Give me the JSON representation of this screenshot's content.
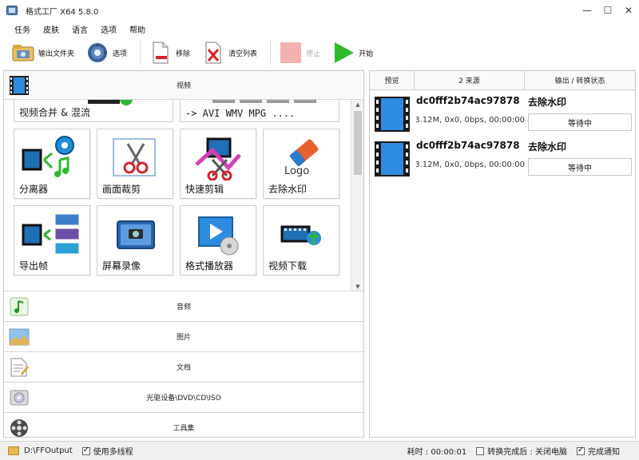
{
  "window": {
    "title": "格式工厂 X64 5.8.0",
    "controls": [
      "—",
      "☐",
      "✕"
    ]
  },
  "menu": [
    "任务",
    "皮肤",
    "语言",
    "选项",
    "帮助"
  ],
  "toolbar": {
    "output_folder": "输出文件夹",
    "options": "选项",
    "remove": "移除",
    "clear_list": "清空列表",
    "stop": "停止",
    "start": "开始"
  },
  "left": {
    "video_category": "视频",
    "tiles_partial": [
      "视频合并 & 混流",
      "-> AVI WMV MPG ...."
    ],
    "tiles": [
      "分离器",
      "画面裁剪",
      "快速剪辑",
      "去除水印",
      "导出帧",
      "屏幕录像",
      "格式播放器",
      "视频下载"
    ],
    "logo_text": "Logo",
    "categories": [
      "音频",
      "图片",
      "文档",
      "光驱设备\\DVD\\CD\\ISO",
      "工具集"
    ]
  },
  "right": {
    "columns": {
      "preview": "预览",
      "source": "2 来源",
      "output": "输出 / 转换状态"
    },
    "tasks": [
      {
        "name": "dc0fff2b74ac97878",
        "action": "去除水印",
        "info": "3.12M, 0x0, 0bps, 00:00:00",
        "status": "等待中"
      },
      {
        "name": "dc0fff2b74ac97878",
        "action": "去除水印",
        "info": "3.12M, 0x0, 0bps, 00:00:00",
        "status": "等待中"
      }
    ]
  },
  "statusbar": {
    "output_path": "D:\\FFOutput",
    "multithread": "使用多线程",
    "elapsed": "耗时 : 00:00:01",
    "after_done": "转换完成后 : 关闭电脑",
    "notify": "完成通知"
  },
  "colors": {
    "accent_green": "#2eb82e",
    "film_blue": "#1e6fb5",
    "disabled_red": "#f3b1b1"
  }
}
